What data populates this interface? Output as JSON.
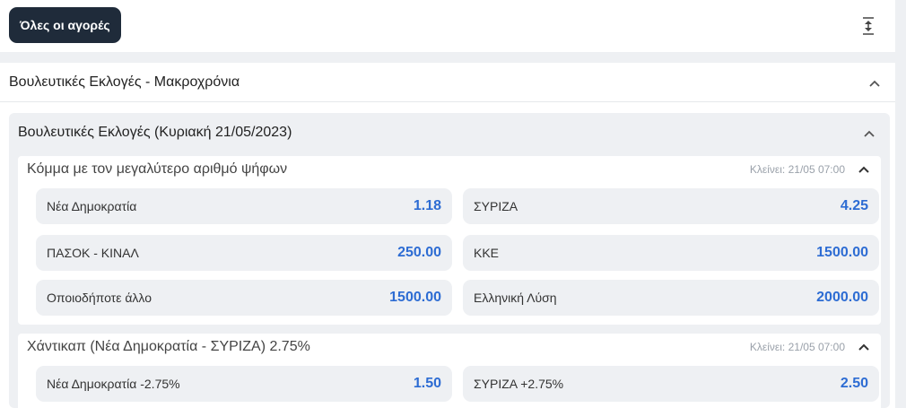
{
  "toolbar": {
    "all_markets_label": "Όλες οι αγορές",
    "collapse_all_icon": "collapse-all-icon"
  },
  "section": {
    "title": "Βουλευτικές Εκλογές - Μακροχρόνια"
  },
  "event": {
    "title": "Βουλευτικές Εκλογές (Κυριακή 21/05/2023)"
  },
  "markets": [
    {
      "title": "Κόμμα με τον μεγαλύτερο αριθμό ψήφων",
      "closes": "Κλείνει: 21/05 07:00",
      "odds": [
        {
          "label": "Νέα Δημοκρατία",
          "value": "1.18"
        },
        {
          "label": "ΣΥΡΙΖΑ",
          "value": "4.25"
        },
        {
          "label": "ΠΑΣΟΚ - ΚΙΝΑΛ",
          "value": "250.00"
        },
        {
          "label": "ΚΚΕ",
          "value": "1500.00"
        },
        {
          "label": "Οποιοδήποτε άλλο",
          "value": "1500.00"
        },
        {
          "label": "Ελληνική Λύση",
          "value": "2000.00"
        }
      ]
    },
    {
      "title": "Χάντικαπ (Νέα Δημοκρατία - ΣΥΡΙΖΑ) 2.75%",
      "closes": "Κλείνει: 21/05 07:00",
      "odds": [
        {
          "label": "Νέα Δημοκρατία -2.75%",
          "value": "1.50"
        },
        {
          "label": "ΣΥΡΙΖΑ +2.75%",
          "value": "2.50"
        }
      ]
    }
  ]
}
